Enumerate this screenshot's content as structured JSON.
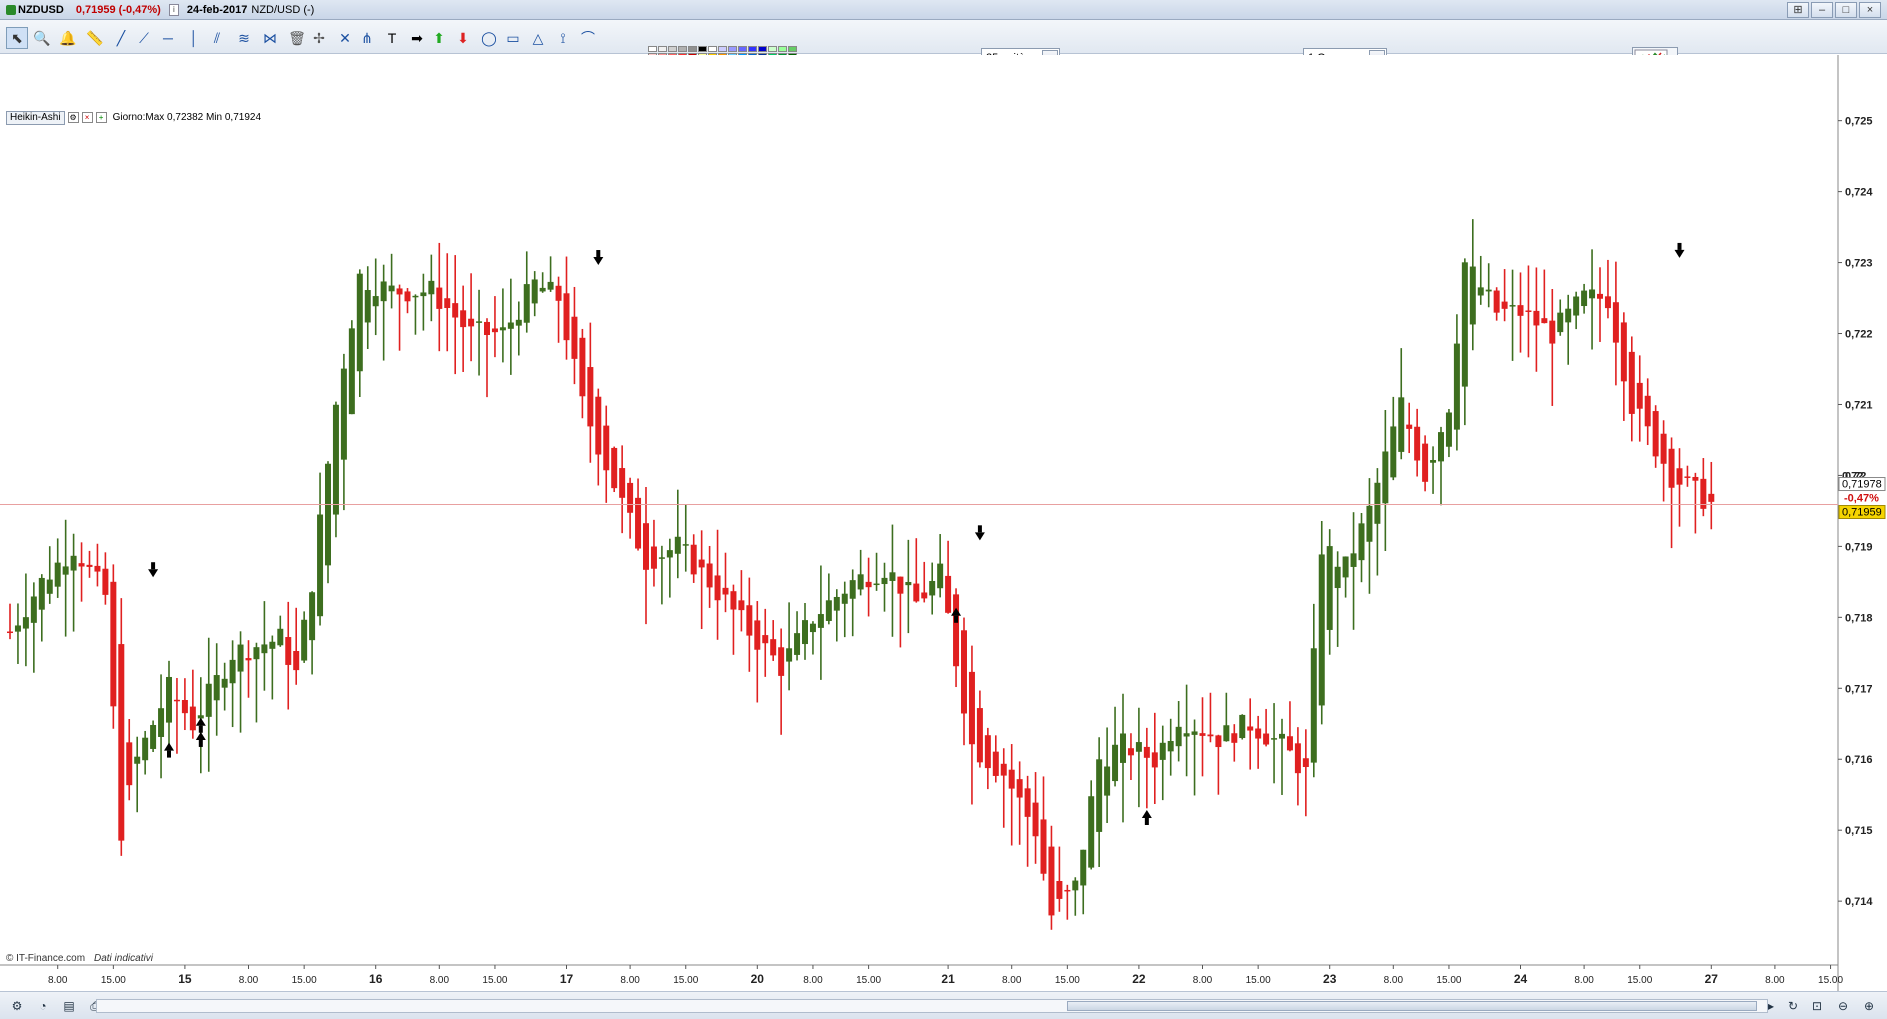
{
  "titlebar": {
    "symbol": "NZDUSD",
    "change": "0,71959 (-0,47%)",
    "date": "24-feb-2017",
    "pair": "NZD/USD (-)",
    "window_buttons": [
      "⊞",
      "–",
      "□",
      "×"
    ]
  },
  "toolbar": {
    "tools": [
      "pointer-tool",
      "zoom-tool",
      "alert-bell-tool",
      "ruler-tool",
      "line-tool",
      "ray-tool",
      "horizontal-line-tool",
      "vertical-line-tool",
      "channel-tool",
      "fibonacci-tool",
      "gann-tool",
      "trash-tool",
      "magnet-tool",
      "cross-tool",
      "pitchfork-tool",
      "text-tool",
      "arrow-right-tool",
      "arrow-up-tool",
      "arrow-down-tool",
      "ellipse-tool",
      "rectangle-tool",
      "triangle-tool",
      "fib-fan-tool",
      "fib-arc-tool"
    ],
    "units_select": "25 unità",
    "timeframe_select": "1 Ora",
    "palette_colors": [
      "#ffffff",
      "#f0f0f0",
      "#d0d0d0",
      "#b0b0b0",
      "#909090",
      "#000000",
      "#ffffff",
      "#ccccff",
      "#9999ff",
      "#6666ff",
      "#3333ff",
      "#0000cc",
      "#ccffcc",
      "#99ff99",
      "#66cc66",
      "#ffcccc",
      "#ff9999",
      "#ff6666",
      "#ff3333",
      "#cc0000",
      "#ffff99",
      "#ffcc00",
      "#ff9900",
      "#66ccff",
      "#0099ff",
      "#0066cc",
      "#003399",
      "#00cc66",
      "#009933",
      "#006600",
      "#ffdddd",
      "#ff7777",
      "#ee2222",
      "#cc1111",
      "#aa0000",
      "#ffee55",
      "#ffaa00",
      "#88ddff",
      "#22aaee",
      "#1177dd",
      "#0044aa",
      "#002288",
      "#55dd88",
      "#22aa44",
      "#117722"
    ]
  },
  "info": {
    "chart_type": "Heikin-Ashi",
    "day_range": "Giorno:Max 0,72382 Min 0,71924"
  },
  "chart_data": {
    "type": "candlestick",
    "style": "Heikin-Ashi",
    "timeframe": "1 Ora",
    "up_color": "#3d6e1f",
    "down_color": "#e02020",
    "ylim": [
      0.7131,
      0.7257
    ],
    "y_ticks": [
      {
        "v": 0.725,
        "label": "0,725"
      },
      {
        "v": 0.724,
        "label": "0,724"
      },
      {
        "v": 0.723,
        "label": "0,723"
      },
      {
        "v": 0.722,
        "label": "0,722"
      },
      {
        "v": 0.721,
        "label": "0,721"
      },
      {
        "v": 0.72,
        "label": "0,72"
      },
      {
        "v": 0.719,
        "label": "0,719"
      },
      {
        "v": 0.718,
        "label": "0,718"
      },
      {
        "v": 0.717,
        "label": "0,717"
      },
      {
        "v": 0.716,
        "label": "0,716"
      },
      {
        "v": 0.715,
        "label": "0,715"
      },
      {
        "v": 0.714,
        "label": "0,714"
      }
    ],
    "x_ticks": [
      {
        "i": 6,
        "label": "8.00",
        "bold": false
      },
      {
        "i": 13,
        "label": "15.00",
        "bold": false
      },
      {
        "i": 22,
        "label": "15",
        "bold": true
      },
      {
        "i": 30,
        "label": "8.00",
        "bold": false
      },
      {
        "i": 37,
        "label": "15.00",
        "bold": false
      },
      {
        "i": 46,
        "label": "16",
        "bold": true
      },
      {
        "i": 54,
        "label": "8.00",
        "bold": false
      },
      {
        "i": 61,
        "label": "15.00",
        "bold": false
      },
      {
        "i": 70,
        "label": "17",
        "bold": true
      },
      {
        "i": 78,
        "label": "8.00",
        "bold": false
      },
      {
        "i": 85,
        "label": "15.00",
        "bold": false
      },
      {
        "i": 94,
        "label": "20",
        "bold": true
      },
      {
        "i": 101,
        "label": "8.00",
        "bold": false
      },
      {
        "i": 108,
        "label": "15.00",
        "bold": false
      },
      {
        "i": 118,
        "label": "21",
        "bold": true
      },
      {
        "i": 126,
        "label": "8.00",
        "bold": false
      },
      {
        "i": 133,
        "label": "15.00",
        "bold": false
      },
      {
        "i": 142,
        "label": "22",
        "bold": true
      },
      {
        "i": 150,
        "label": "8.00",
        "bold": false
      },
      {
        "i": 157,
        "label": "15.00",
        "bold": false
      },
      {
        "i": 166,
        "label": "23",
        "bold": true
      },
      {
        "i": 174,
        "label": "8.00",
        "bold": false
      },
      {
        "i": 181,
        "label": "15.00",
        "bold": false
      },
      {
        "i": 190,
        "label": "24",
        "bold": true
      },
      {
        "i": 198,
        "label": "8.00",
        "bold": false
      },
      {
        "i": 205,
        "label": "15.00",
        "bold": false
      },
      {
        "i": 214,
        "label": "27",
        "bold": true
      },
      {
        "i": 222,
        "label": "8.00",
        "bold": false
      },
      {
        "i": 229,
        "label": "15.00",
        "bold": false
      }
    ],
    "anchors": [
      [
        0,
        0.7178
      ],
      [
        4,
        0.7185
      ],
      [
        8,
        0.719
      ],
      [
        12,
        0.7183
      ],
      [
        14,
        0.715
      ],
      [
        16,
        0.716
      ],
      [
        20,
        0.717
      ],
      [
        23,
        0.7165
      ],
      [
        28,
        0.7175
      ],
      [
        34,
        0.7177
      ],
      [
        36,
        0.7172
      ],
      [
        38,
        0.7185
      ],
      [
        41,
        0.721
      ],
      [
        44,
        0.7228
      ],
      [
        48,
        0.7226
      ],
      [
        53,
        0.7226
      ],
      [
        58,
        0.722
      ],
      [
        62,
        0.722
      ],
      [
        66,
        0.7227
      ],
      [
        69,
        0.7225
      ],
      [
        72,
        0.721
      ],
      [
        77,
        0.7196
      ],
      [
        80,
        0.7188
      ],
      [
        84,
        0.719
      ],
      [
        88,
        0.7185
      ],
      [
        93,
        0.7178
      ],
      [
        97,
        0.7173
      ],
      [
        101,
        0.718
      ],
      [
        106,
        0.7185
      ],
      [
        110,
        0.7187
      ],
      [
        114,
        0.7182
      ],
      [
        117,
        0.7186
      ],
      [
        118,
        0.718
      ],
      [
        121,
        0.7162
      ],
      [
        125,
        0.7158
      ],
      [
        129,
        0.715
      ],
      [
        131,
        0.7138
      ],
      [
        134,
        0.7142
      ],
      [
        137,
        0.716
      ],
      [
        140,
        0.7162
      ],
      [
        144,
        0.716
      ],
      [
        147,
        0.7166
      ],
      [
        152,
        0.7163
      ],
      [
        156,
        0.7165
      ],
      [
        160,
        0.7162
      ],
      [
        163,
        0.7158
      ],
      [
        165,
        0.719
      ],
      [
        168,
        0.7187
      ],
      [
        171,
        0.7195
      ],
      [
        175,
        0.721
      ],
      [
        178,
        0.72
      ],
      [
        181,
        0.721
      ],
      [
        183,
        0.723
      ],
      [
        187,
        0.7223
      ],
      [
        190,
        0.7223
      ],
      [
        194,
        0.722
      ],
      [
        198,
        0.7225
      ],
      [
        201,
        0.7225
      ],
      [
        204,
        0.721
      ],
      [
        209,
        0.72
      ],
      [
        214,
        0.7196
      ]
    ],
    "arrows": [
      {
        "i": 18,
        "dir": "down",
        "price": 0.71865
      },
      {
        "i": 24,
        "dir": "up",
        "price": 0.7165
      },
      {
        "i": 20,
        "dir": "up",
        "price": 0.71615
      },
      {
        "i": 24,
        "dir": "up",
        "price": 0.7163
      },
      {
        "i": 74,
        "dir": "down",
        "price": 0.72305
      },
      {
        "i": 122,
        "dir": "down",
        "price": 0.71917
      },
      {
        "i": 119,
        "dir": "up",
        "price": 0.71805
      },
      {
        "i": 143,
        "dir": "up",
        "price": 0.7152
      },
      {
        "i": 210,
        "dir": "down",
        "price": 0.72315
      }
    ],
    "price_labels": {
      "upper": "0,71978",
      "pct": "-0,47%",
      "last": "0,71959",
      "partial_tick": "0,72"
    },
    "current_price": 0.71959,
    "watermark": "© IT-Finance.com",
    "watermark_note": "Dati indicativi"
  },
  "bottombar": {
    "icons": [
      "chart-settings-icon",
      "indicators-icon",
      "save-layout-icon",
      "print-icon"
    ],
    "right_icons": [
      "scroll-right-icon",
      "refresh-icon",
      "zoom-reset-icon",
      "zoom-out-icon",
      "zoom-in-icon"
    ]
  }
}
